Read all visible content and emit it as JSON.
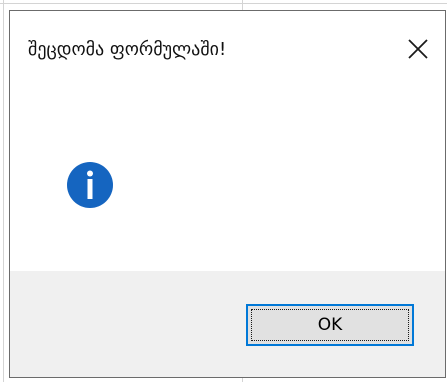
{
  "dialog": {
    "title": "შეცდომა ფორმულაში!",
    "icon": "info-icon",
    "ok_label": "OK",
    "close_icon": "close-icon"
  },
  "colors": {
    "info_icon": "#1565c0",
    "button_border": "#0078d7",
    "button_face": "#e1e1e1",
    "footer_bg": "#f0f0f0"
  }
}
